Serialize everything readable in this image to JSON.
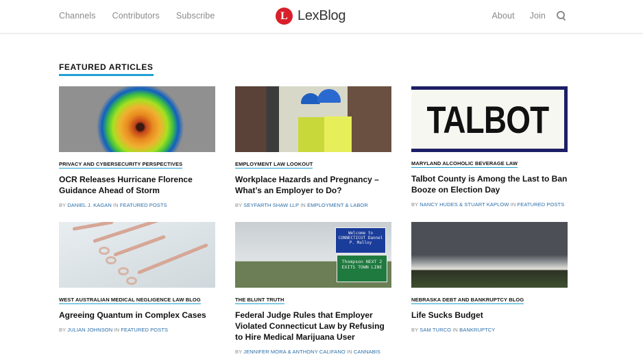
{
  "header": {
    "nav_left": [
      "Channels",
      "Contributors",
      "Subscribe"
    ],
    "logo_letter": "L",
    "logo_text": "LexBlog",
    "nav_right": [
      "About",
      "Join"
    ],
    "search_icon": "search-icon"
  },
  "colors": {
    "accent": "#1ea0d3",
    "brand_red": "#d91f2a",
    "link_blue": "#2b6ea8"
  },
  "section": {
    "title": "FEATURED ARTICLES"
  },
  "articles": [
    {
      "image": "hurricane satellite image",
      "category": "PRIVACY AND CYBERSECURITY PERSPECTIVES",
      "title": "OCR Releases Hurricane Florence Guidance Ahead of Storm",
      "by": "BY",
      "author": "DANIEL J. KAGAN",
      "in": "IN",
      "channel": "FEATURED POSTS"
    },
    {
      "image": "workers in hard hats",
      "category": "EMPLOYMENT LAW LOOKOUT",
      "title": "Workplace Hazards and Pregnancy – What’s an Employer to Do?",
      "by": "BY",
      "author": "SEYFARTH SHAW LLP",
      "in": "IN",
      "channel": "EMPLOYMENT & LABOR"
    },
    {
      "image": "Talbot sign",
      "image_text": "TALBOT",
      "category": "MARYLAND ALCOHOLIC BEVERAGE LAW",
      "title": "Talbot County is Among the Last to Ban Booze on Election Day",
      "by": "BY",
      "author": "NANCY HUDES & STUART KAPLOW",
      "in": "IN",
      "channel": "FEATURED POSTS"
    },
    {
      "image": "surgical scissors",
      "category": "WEST AUSTRALIAN MEDICAL NEGLIGENCE LAW BLOG",
      "title": "Agreeing Quantum in Complex Cases",
      "by": "BY",
      "author": "JULIAN JOHNSON",
      "in": "IN",
      "channel": "FEATURED POSTS"
    },
    {
      "image": "Welcome to Connecticut sign",
      "sign_top": "Welcome to CONNECTICUT Dannel P. Malloy",
      "sign_bottom": "Thompson NEXT 2 EXITS TOWN LINE",
      "category": "THE BLUNT TRUTH",
      "title": "Federal Judge Rules that Employer Violated Connecticut Law by Refusing to Hire Medical Marijuana User",
      "by": "BY",
      "author": "JENNIFER MORA & ANTHONY CALIFANO",
      "in": "IN",
      "channel": "CANNABIS"
    },
    {
      "image": "storm clouds over field",
      "category": "NEBRASKA DEBT AND BANKRUPTCY BLOG",
      "title": "Life Sucks Budget",
      "by": "BY",
      "author": "SAM TURCO",
      "in": "IN",
      "channel": "BANKRUPTCY"
    }
  ]
}
